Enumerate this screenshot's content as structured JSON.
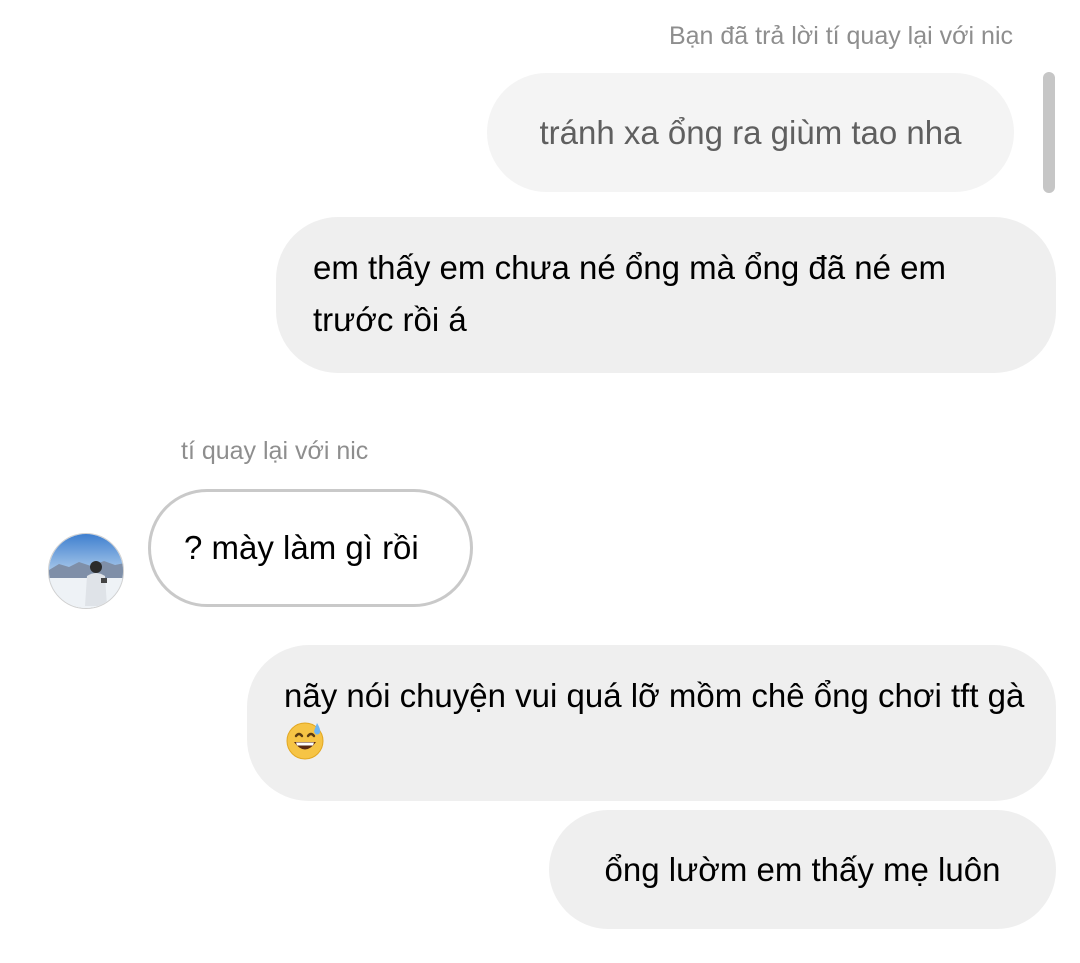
{
  "thread": {
    "reply_context_label": "Bạn đã trả lời tí quay lại với nic",
    "quoted_message": "tránh xa ổng ra giùm tao nha",
    "messages": [
      {
        "direction": "outgoing",
        "text": "em thấy em chưa né ổng mà ổng đã né em trước rồi á"
      },
      {
        "direction": "incoming",
        "sender": "tí quay lại với nic",
        "text": "? mày làm gì rồi",
        "avatar_icon": "contact-avatar-photo"
      },
      {
        "direction": "outgoing",
        "text": "nãy nói chuyện vui quá lỡ mồm chê ổng chơi tft gà",
        "emoji": "grinning-face-with-sweat-emoji"
      },
      {
        "direction": "outgoing",
        "text": "ổng lườm em thấy mẹ luôn"
      }
    ]
  },
  "colors": {
    "outgoing_bubble": "#efefef",
    "quoted_bubble": "#f4f4f4",
    "incoming_border": "#c9c9c9",
    "meta_text": "#8e8e8e"
  }
}
